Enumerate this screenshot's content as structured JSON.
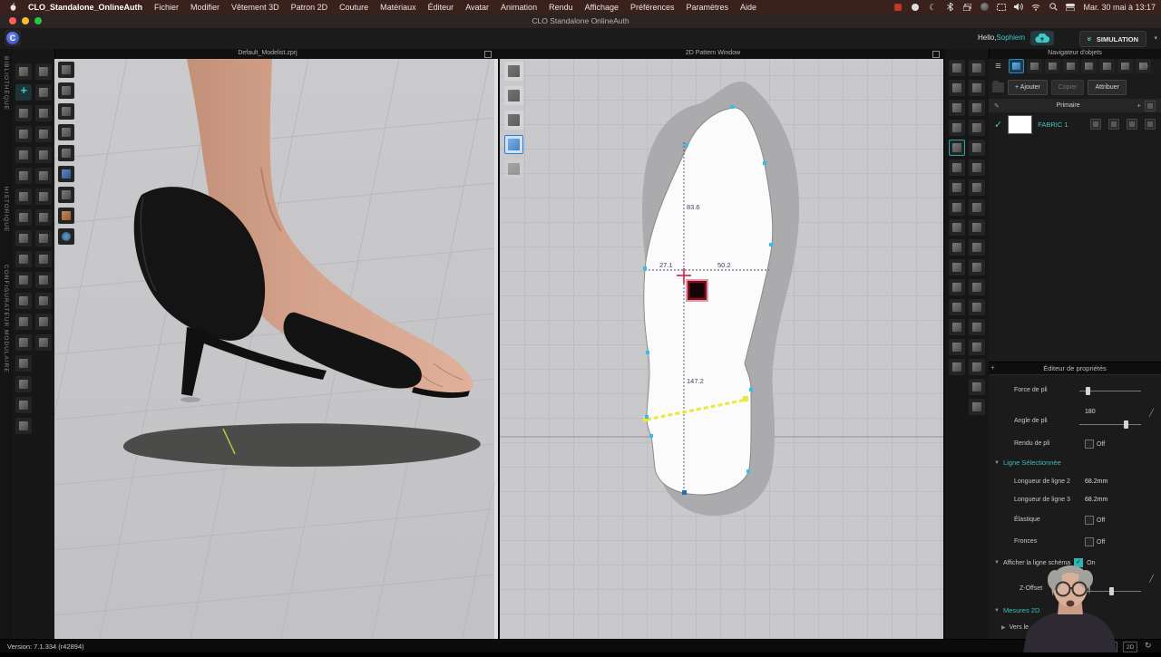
{
  "icons": {
    "hamburger": "≡",
    "check": "✓",
    "caret_down": "▾",
    "section_expanded": "▼",
    "section_collapsed": "▶",
    "chevron_nav": "‹ ›",
    "refresh": "↻",
    "moon": "☾",
    "plus": "+",
    "pencil": "✎",
    "simulation_chevrons": "»",
    "curve": "╱"
  },
  "menubar": {
    "app_name": "CLO_Standalone_OnlineAuth",
    "items": [
      "Fichier",
      "Modifier",
      "Vêtement 3D",
      "Patron 2D",
      "Couture",
      "Matériaux",
      "Éditeur",
      "Avatar",
      "Animation",
      "Rendu",
      "Affichage",
      "Préférences",
      "Paramètres",
      "Aide"
    ],
    "clock": "Mar. 30 mai à 13:17"
  },
  "titlebar": {
    "title": "CLO Standalone OnlineAuth"
  },
  "toolbar": {
    "greeting_prefix": "Hello,",
    "username": "Sophiem",
    "simulation_label": "SIMULATION"
  },
  "sidebar": {
    "tabs": [
      "BIBLIOTHÈQUE",
      "HISTORIQUE",
      "CONFIGURATEUR MODULAIRE"
    ]
  },
  "viewport3d": {
    "title": "Default_Modelist.zprj"
  },
  "viewport2d": {
    "title": "2D Pattern Window",
    "measurements": {
      "upper": "83.6",
      "left": "27.1",
      "right": "50.2",
      "lower": "147.2"
    }
  },
  "object_browser": {
    "title": "Navigateur d'objets",
    "add_label": "+ Ajouter",
    "copy_label": "Copier",
    "assign_label": "Attribuer",
    "section_label": "Primaire",
    "fabric_name": "FABRIC 1",
    "fabric_swatch_color": "#ffffff"
  },
  "property_editor": {
    "title": "Éditeur de propriétés",
    "fold_strength": "Force de pli",
    "fold_angle": "Angle de pli",
    "fold_angle_value": "180",
    "fold_render": "Rendu de pli",
    "fold_render_value": "Off",
    "selected_line": "Ligne Sélectionnée",
    "len2": "Longueur de ligne 2",
    "len2_value": "68.2mm",
    "len3": "Longueur de ligne 3",
    "len3_value": "68.2mm",
    "elastic": "Élastique",
    "elastic_value": "Off",
    "shirring": "Fronces",
    "shirring_value": "Off",
    "schematic": "Afficher la ligne schéma",
    "schematic_value": "On",
    "zoffset": "Z-Offset",
    "zoffset_value": "0",
    "measures2d": "Mesures 2D",
    "towards": "Vers le"
  },
  "statusbar": {
    "version": "Version: 7.1.334 (r42894)",
    "btn_3d": "3D",
    "btn_2d": "2D"
  },
  "colors": {
    "accent_teal": "#3fc9c9",
    "selection_blue": "#2e86b8",
    "highlight_yellow": "#e9e93a",
    "cursor_red": "#c81e3c",
    "pattern_point_cyan": "#35bde8"
  }
}
